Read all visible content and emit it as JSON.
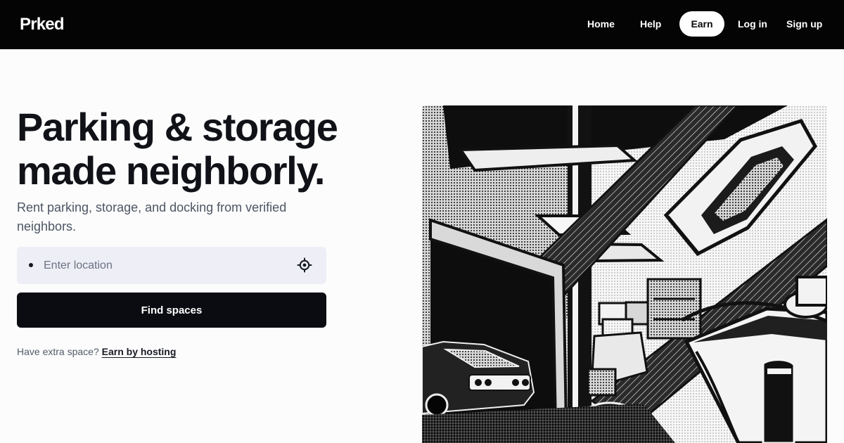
{
  "brand": {
    "name": "Prked",
    "colors": {
      "navbar": "#040404",
      "primary_button": "#0a0c12",
      "field_background": "#edeef6",
      "page_background": "#fcfcfc"
    }
  },
  "nav": {
    "home": "Home",
    "help": "Help",
    "earn": "Earn",
    "login": "Log in",
    "signup": "Sign up"
  },
  "hero": {
    "title_line1": "Parking & storage",
    "title_line2": "made neighborly.",
    "subtitle": "Rent parking, storage, and docking from verified neighbors.",
    "location_placeholder": "Enter location",
    "location_value": "",
    "find_button": "Find spaces",
    "host_prompt": "Have extra space?",
    "host_link": "Earn by hosting"
  },
  "icons": {
    "location_dot": "dot-icon",
    "locate": "crosshair-locate-icon"
  },
  "illustration": {
    "subject": "black-and-white halftone illustration of a parking garage, storage boxes, a classic car and a docked boat"
  }
}
